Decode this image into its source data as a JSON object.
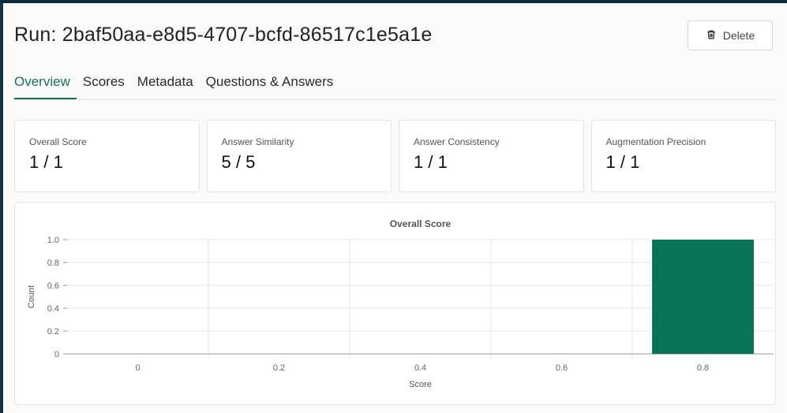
{
  "header": {
    "title": "Run: 2baf50aa-e8d5-4707-bcfd-86517c1e5a1e",
    "delete_label": "Delete"
  },
  "tabs": [
    {
      "label": "Overview"
    },
    {
      "label": "Scores"
    },
    {
      "label": "Metadata"
    },
    {
      "label": "Questions & Answers"
    }
  ],
  "cards": [
    {
      "label": "Overall Score",
      "value": "1 / 1"
    },
    {
      "label": "Answer Similarity",
      "value": "5 / 5"
    },
    {
      "label": "Answer Consistency",
      "value": "1 / 1"
    },
    {
      "label": "Augmentation Precision",
      "value": "1 / 1"
    }
  ],
  "colors": {
    "accent": "#1b6d55",
    "bar": "#0b7355"
  },
  "chart_data": {
    "type": "bar",
    "title": "Overall Score",
    "xlabel": "Score",
    "ylabel": "Count",
    "categories": [
      "0",
      "0.2",
      "0.4",
      "0.6",
      "0.8"
    ],
    "values": [
      0,
      0,
      0,
      0,
      1
    ],
    "yticks": [
      "0",
      "0.2",
      "0.4",
      "0.6",
      "0.8",
      "1.0"
    ],
    "ylim": [
      0,
      1
    ],
    "grid": true
  }
}
